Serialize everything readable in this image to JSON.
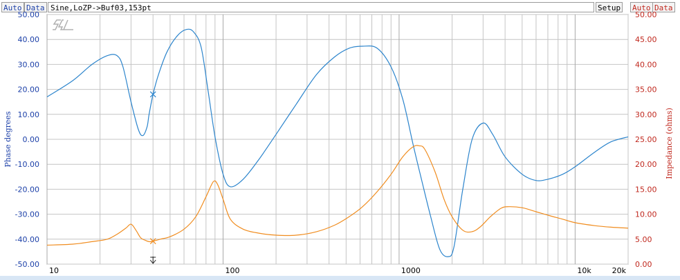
{
  "toolbar": {
    "left_auto": "Auto",
    "left_data": "Data",
    "title": "Sine,LoZP->Buf03,153pt",
    "setup": "Setup",
    "right_auto": "Auto",
    "right_data": "Data"
  },
  "logo_text": "SL",
  "colors": {
    "phase": "#2b84cc",
    "impedance": "#f08c1e",
    "left_axis": "#1b3fa8",
    "right_axis": "#c0281e",
    "grid": "#c4c4c4"
  },
  "chart_data": {
    "type": "line",
    "x_scale": "log",
    "xlim": [
      10,
      20000
    ],
    "x_ticks": [
      10,
      100,
      1000,
      10000,
      20000
    ],
    "x_tick_labels": [
      "10",
      "100",
      "1000",
      "10k",
      "20k"
    ],
    "ylabel_left": "Phase degrees",
    "ylabel_right": "Impedance (ohms)",
    "ylim_left": [
      -50,
      50
    ],
    "ylim_right": [
      0,
      50
    ],
    "y_ticks_left": [
      "50.00",
      "40.00",
      "30.00",
      "20.00",
      "10.00",
      "0.00",
      "-10.00",
      "-20.00",
      "-30.00",
      "-40.00",
      "-50.00"
    ],
    "y_ticks_right": [
      "50.00",
      "45.00",
      "40.00",
      "35.00",
      "30.00",
      "25.00",
      "20.00",
      "15.00",
      "10.00",
      "5.00",
      "0.00"
    ],
    "grid": true,
    "cursor_x": 40,
    "series": [
      {
        "axis": "left",
        "x": [
          10,
          14,
          18,
          22,
          25,
          27,
          30,
          33,
          35,
          37,
          38,
          40,
          43,
          48,
          55,
          62,
          68,
          75,
          82,
          90,
          100,
          110,
          130,
          160,
          200,
          260,
          340,
          430,
          520,
          620,
          750,
          900,
          1050,
          1200,
          1350,
          1500,
          1700,
          1900,
          2050,
          2300,
          2600,
          3000,
          3400,
          4000,
          5000,
          6000,
          7000,
          8500,
          10000,
          13000,
          16000,
          20000
        ],
        "y": [
          17,
          23.5,
          30,
          33.5,
          33.5,
          29,
          15,
          4,
          1.5,
          5,
          10,
          18,
          26,
          35,
          41.5,
          44,
          43,
          37,
          20,
          1,
          -14,
          -19,
          -16,
          -8,
          2,
          14,
          26,
          33,
          36.5,
          37.3,
          36.5,
          29,
          16,
          -2,
          -17,
          -30,
          -44,
          -47,
          -43,
          -20,
          0,
          6.5,
          2,
          -7,
          -14,
          -16.5,
          -16,
          -14,
          -11,
          -5,
          -1,
          1
        ]
      },
      {
        "axis": "right",
        "x": [
          10,
          14,
          18,
          22,
          25,
          28,
          30,
          32,
          34,
          36,
          38,
          40,
          44,
          50,
          60,
          70,
          80,
          88,
          93,
          100,
          110,
          130,
          160,
          200,
          260,
          340,
          430,
          520,
          620,
          750,
          900,
          1050,
          1200,
          1300,
          1400,
          1600,
          1800,
          2000,
          2300,
          2600,
          2900,
          3300,
          3800,
          4200,
          5000,
          6000,
          7000,
          8500,
          10000,
          13000,
          16000,
          20000
        ],
        "y": [
          3.8,
          4,
          4.5,
          5,
          6,
          7.2,
          8,
          6.8,
          5.3,
          4.8,
          4.5,
          4.6,
          5,
          5.5,
          7,
          9.5,
          13.5,
          16.5,
          16,
          13,
          9,
          7,
          6.2,
          5.8,
          5.8,
          6.5,
          7.8,
          9.5,
          11.5,
          14.5,
          18,
          21.5,
          23.5,
          23.7,
          23,
          18.5,
          13,
          9.5,
          6.8,
          6.5,
          7.5,
          9.5,
          11.2,
          11.5,
          11.3,
          10.5,
          9.8,
          9,
          8.3,
          7.7,
          7.4,
          7.2
        ]
      }
    ]
  }
}
